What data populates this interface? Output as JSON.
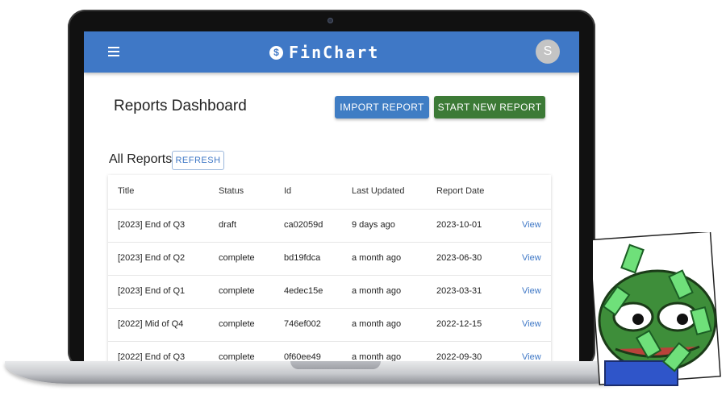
{
  "app": {
    "name": "FinChart",
    "user_initial": "S"
  },
  "page": {
    "title": "Reports Dashboard"
  },
  "actions": {
    "import_label": "IMPORT REPORT",
    "new_label": "START NEW REPORT"
  },
  "section": {
    "title": "All Reports",
    "refresh_label": "REFRESH"
  },
  "table": {
    "columns": [
      "Title",
      "Status",
      "Id",
      "Last Updated",
      "Report Date"
    ],
    "rows": [
      {
        "title": "[2023] End of Q3",
        "status": "draft",
        "id": "ca02059d",
        "updated": "9 days ago",
        "date": "2023-10-01",
        "action": "View"
      },
      {
        "title": "[2023] End of Q2",
        "status": "complete",
        "id": "bd19fdca",
        "updated": "a month ago",
        "date": "2023-06-30",
        "action": "View"
      },
      {
        "title": "[2023] End of Q1",
        "status": "complete",
        "id": "4edec15e",
        "updated": "a month ago",
        "date": "2023-03-31",
        "action": "View"
      },
      {
        "title": "[2022] Mid of Q4",
        "status": "complete",
        "id": "746ef002",
        "updated": "a month ago",
        "date": "2022-12-15",
        "action": "View"
      },
      {
        "title": "[2022] End of Q3",
        "status": "complete",
        "id": "0f60ee49",
        "updated": "a month ago",
        "date": "2022-09-30",
        "action": "View"
      }
    ]
  },
  "colors": {
    "primary": "#3f78c6",
    "success": "#3c7a36",
    "text": "#222222"
  }
}
